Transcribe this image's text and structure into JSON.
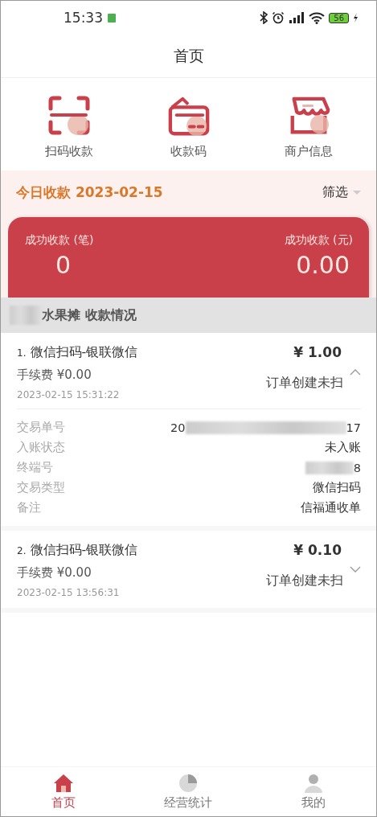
{
  "status_bar": {
    "time": "15:33",
    "battery": "56"
  },
  "header": {
    "title": "首页"
  },
  "shortcuts": [
    {
      "kind": "scan",
      "label": "扫码收款"
    },
    {
      "kind": "wallet",
      "label": "收款码"
    },
    {
      "kind": "shop",
      "label": "商户信息"
    }
  ],
  "today": {
    "title": "今日收款 2023-02-15",
    "filter": "筛选"
  },
  "summary": [
    {
      "label": "成功收款 (笔)",
      "value": "0"
    },
    {
      "label": "成功收款 (元)",
      "value": "0.00"
    }
  ],
  "section": {
    "title": "水果摊 收款情况"
  },
  "transactions": [
    {
      "index": "1.",
      "name": "微信扫码-银联微信",
      "amount": "¥ 1.00",
      "fee": "手续费 ¥0.00",
      "status": "订单创建未扫",
      "time": "2023-02-15 15:31:22",
      "expanded": true,
      "details": [
        {
          "label": "交易单号",
          "value": [
            {
              "kind": "text",
              "text": "20"
            },
            {
              "kind": "blur"
            },
            {
              "kind": "text",
              "text": "17"
            }
          ]
        },
        {
          "label": "入账状态",
          "value": [
            {
              "kind": "text",
              "text": "未入账"
            }
          ]
        },
        {
          "label": "终端号",
          "value": [
            {
              "kind": "blur"
            },
            {
              "kind": "text",
              "text": "8"
            }
          ]
        },
        {
          "label": "交易类型",
          "value": [
            {
              "kind": "text",
              "text": "微信扫码"
            }
          ]
        },
        {
          "label": "备注",
          "value": [
            {
              "kind": "text",
              "text": "信福通收单"
            }
          ]
        }
      ]
    },
    {
      "index": "2.",
      "name": "微信扫码-银联微信",
      "amount": "¥ 0.10",
      "fee": "手续费 ¥0.00",
      "status": "订单创建未扫",
      "time": "2023-02-15 13:56:31",
      "expanded": false
    }
  ],
  "tab_bar": [
    {
      "kind": "home",
      "label": "首页",
      "selected": true
    },
    {
      "kind": "chart",
      "label": "经营统计",
      "selected": false
    },
    {
      "kind": "user",
      "label": "我的",
      "selected": false
    }
  ]
}
